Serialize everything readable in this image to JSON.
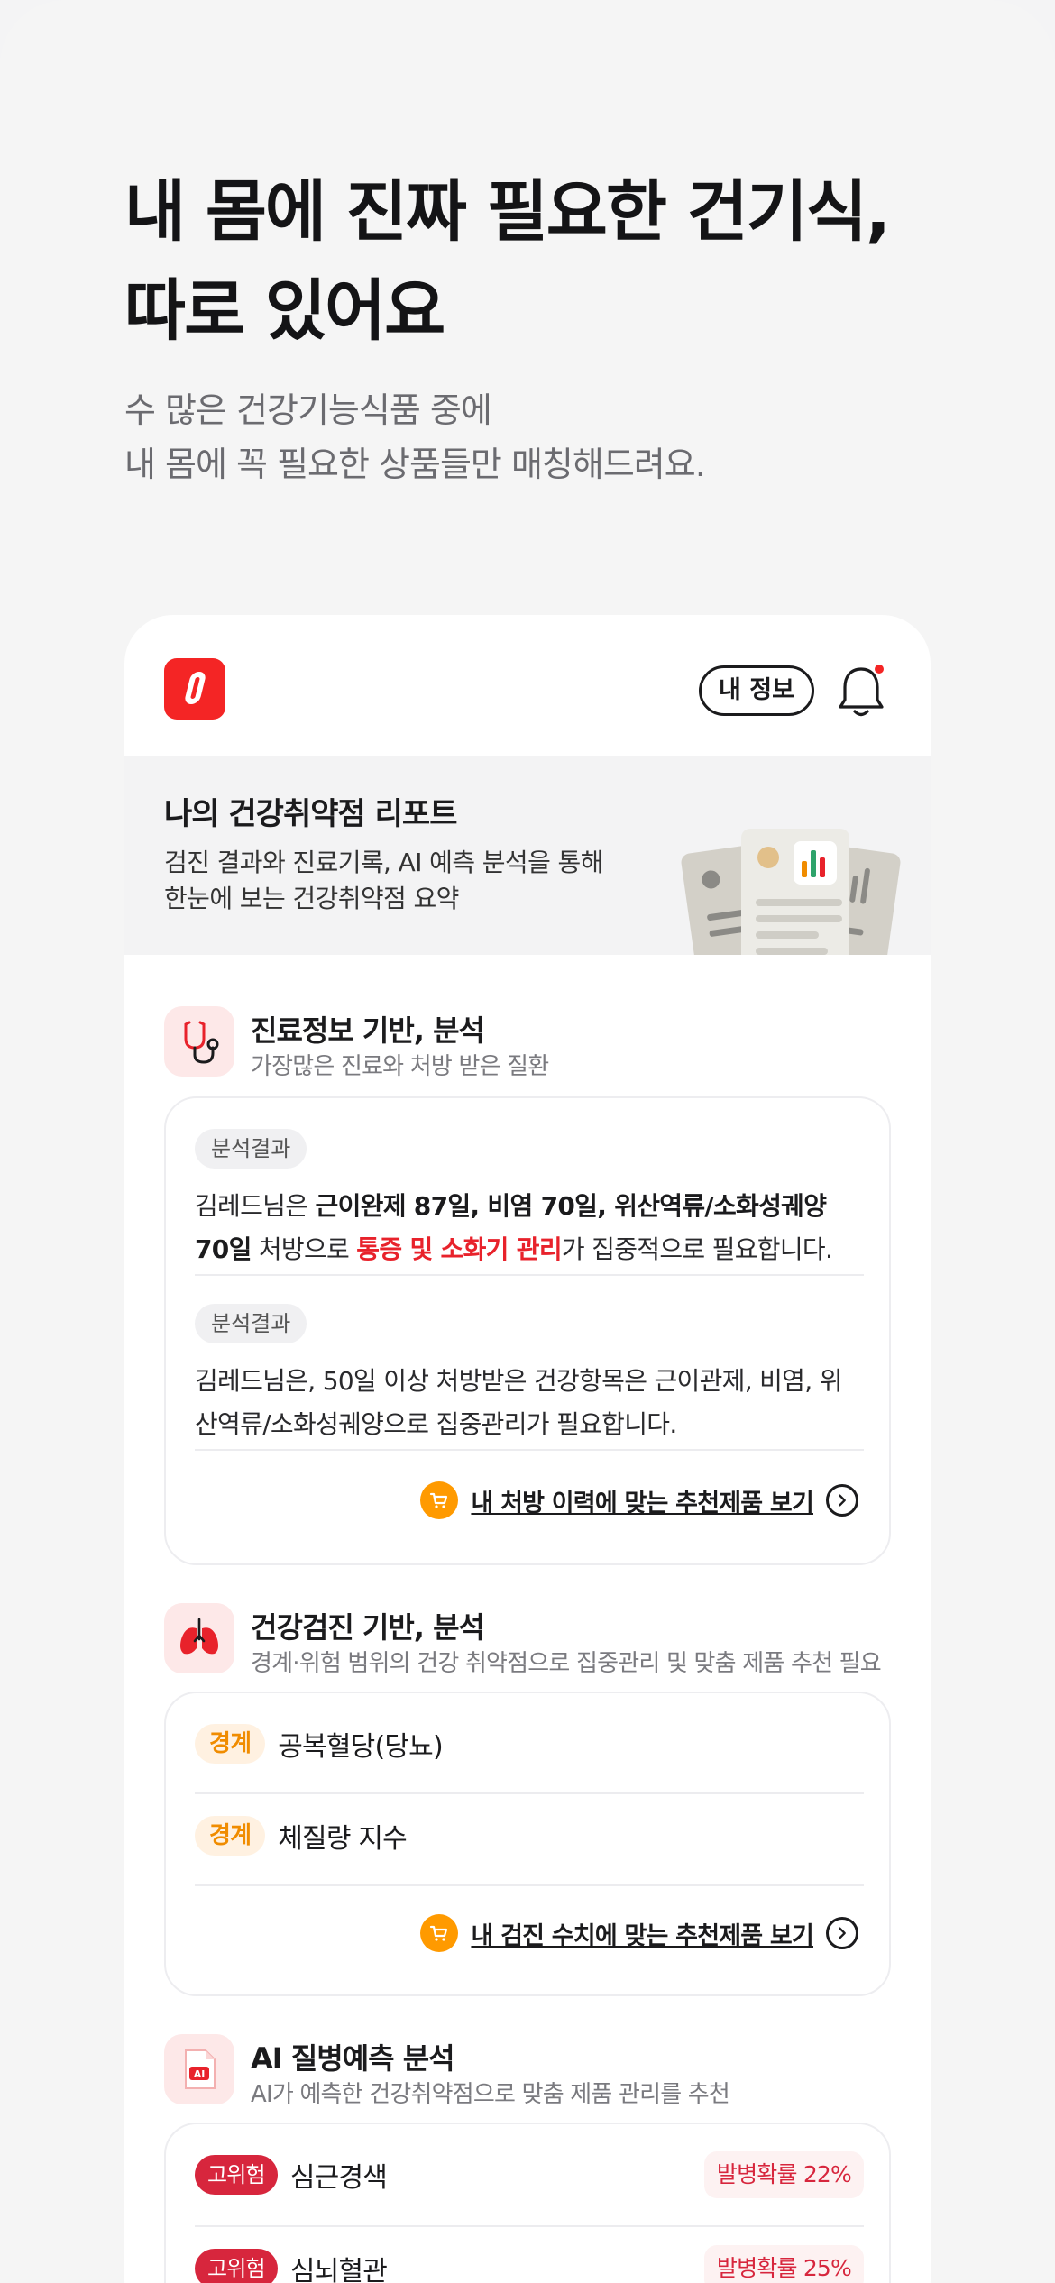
{
  "hero": {
    "title_line1": "내 몸에 진짜 필요한 건기식,",
    "title_line2": "따로 있어요",
    "subtitle_line1": "수 많은 건강기능식품 중에",
    "subtitle_line2": "내 몸에 꼭 필요한 상품들만 매칭해드려요."
  },
  "app": {
    "header": {
      "my_info_label": "내 정보",
      "icons": [
        "logo-icon",
        "bell-icon"
      ],
      "accent": "#f42525"
    },
    "report": {
      "title": "나의 건강취약점 리포트",
      "desc_line1": "검진 결과와 진료기록, AI 예측 분석을 통해",
      "desc_line2": "한눈에 보는 건강취약점 요약"
    },
    "medical": {
      "title": "진료정보 기반, 분석",
      "subtitle": "가장많은 진료와 처방 받은 질환",
      "icon": "stethoscope-icon",
      "results": [
        {
          "tag": "분석결과",
          "p1": "김레드님은 ",
          "b1": "근이완제 87일, 비염 70일, 위산역류/소화성궤양 70일",
          "p2": " 처방으로 ",
          "highlight": "통증 및 소화기 관리",
          "p3": "가 집중적으로 필요합니다."
        },
        {
          "tag": "분석결과",
          "text": "김레드님은, 50일 이상 처방받은 건강항목은 근이관제, 비염, 위산역류/소화성궤양으로 집중관리가 필요합니다."
        }
      ],
      "link": "내 처방 이력에 맞는 추천제품 보기"
    },
    "checkup": {
      "title": "건강검진 기반, 분석",
      "subtitle": "경계·위험 범위의 건강 취약점으로 집중관리 및 맞춤 제품 추천 필요",
      "icon": "lungs-icon",
      "items": [
        {
          "level": "경계",
          "name": "공복혈당(당뇨)"
        },
        {
          "level": "경계",
          "name": "체질량 지수"
        }
      ],
      "link": "내 검진 수치에 맞는 추천제품 보기"
    },
    "ai": {
      "title": "AI 질병예측 분석",
      "subtitle": "AI가 예측한 건강취약점으로 맞춤 제품 관리를 추천",
      "icon": "ai-file-icon",
      "items": [
        {
          "level": "고위험",
          "name": "심근경색",
          "prob": "발병확률 22%"
        },
        {
          "level": "고위험",
          "name": "심뇌혈관",
          "prob": "발병확률 25%"
        }
      ]
    }
  }
}
